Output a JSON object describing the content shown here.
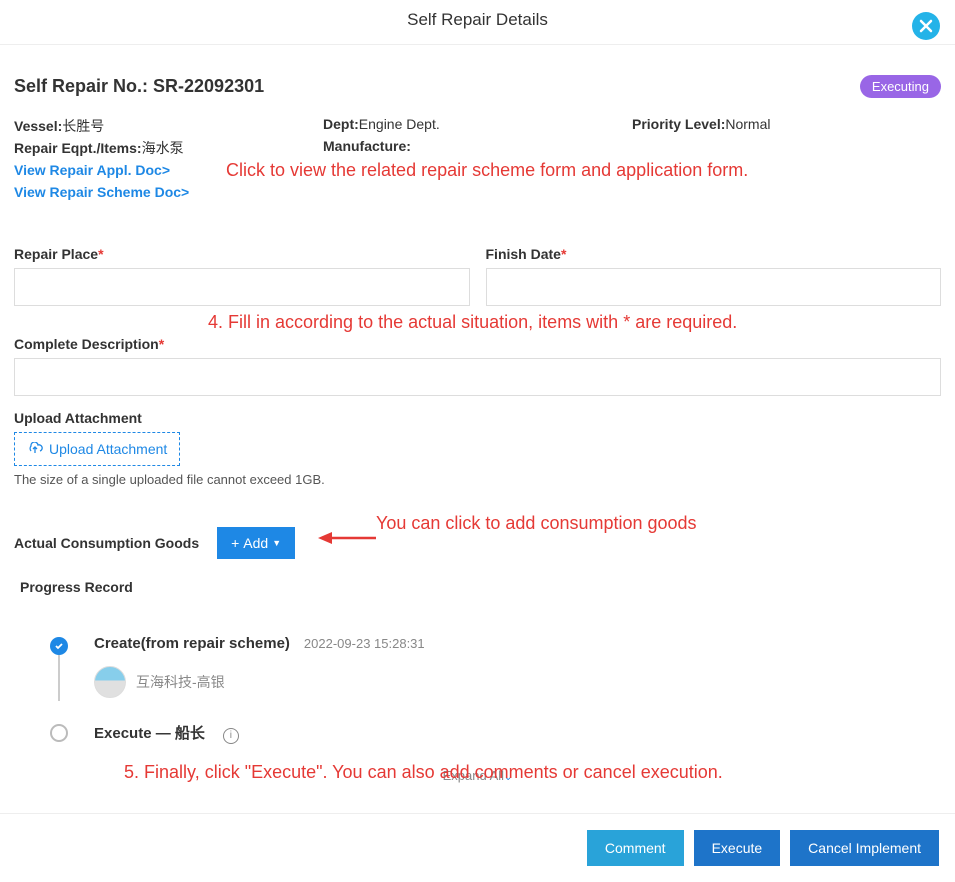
{
  "header": {
    "title": "Self Repair Details"
  },
  "title_row": {
    "label": "Self Repair No.: SR-22092301",
    "status": "Executing"
  },
  "info": {
    "vessel_label": "Vessel:",
    "vessel_value": "长胜号",
    "dept_label": "Dept:",
    "dept_value": "Engine Dept.",
    "priority_label": "Priority Level:",
    "priority_value": "Normal",
    "eqpt_label": "Repair Eqpt./Items:",
    "eqpt_value": "海水泵",
    "manufacture_label": "Manufacture:"
  },
  "links": {
    "view_appl": "View Repair Appl. Doc>",
    "view_scheme": "View Repair Scheme Doc>"
  },
  "annotations": {
    "a1": "Click to view the related repair scheme form and application form.",
    "a2": "4. Fill in according to the actual situation, items with * are required.",
    "a3": "You can click to add consumption goods",
    "a4": "5. Finally, click \"Execute\". You can also add comments or cancel execution."
  },
  "form": {
    "repair_place_label": "Repair Place",
    "finish_date_label": "Finish Date",
    "complete_desc_label": "Complete Description",
    "upload_label": "Upload Attachment",
    "upload_btn": "Upload Attachment",
    "upload_hint": "The size of a single uploaded file cannot exceed 1GB."
  },
  "goods": {
    "label": "Actual Consumption Goods",
    "add_btn": "Add"
  },
  "progress": {
    "title": "Progress Record",
    "step1_title": "Create(from repair scheme)",
    "step1_time": "2022-09-23 15:28:31",
    "step1_user": "互海科技-高银",
    "step2_title": "Execute — 船长",
    "expand_all": "Expand All"
  },
  "footer": {
    "comment": "Comment",
    "execute": "Execute",
    "cancel": "Cancel Implement"
  }
}
